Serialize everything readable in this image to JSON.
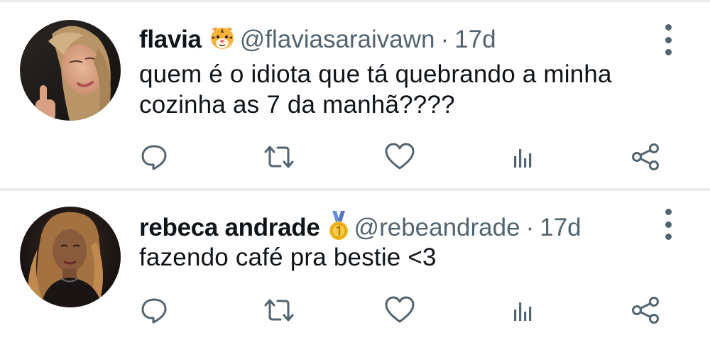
{
  "tweets": [
    {
      "name": "flavia",
      "badge_icon": "tiger-face-emoji",
      "handle": "@flaviasaraivawn",
      "separator": "·",
      "time": "17d",
      "text_lines": [
        "quem é o idiota que tá quebrando a minha",
        "cozinha as 7 da manhã????"
      ]
    },
    {
      "name": "rebeca andrade",
      "badge_icon": "gold-medal-emoji",
      "handle": "@rebeandrade",
      "separator": "·",
      "time": "17d",
      "text_lines": [
        "fazendo café pra bestie <3"
      ]
    }
  ],
  "icons": {
    "reply": "reply-icon",
    "retweet": "retweet-icon",
    "like": "like-icon",
    "views": "views-icon",
    "share": "share-icon",
    "more": "more-options-icon"
  },
  "colors": {
    "text": "#0f1419",
    "secondary": "#536471",
    "divider": "#e9ecee"
  }
}
